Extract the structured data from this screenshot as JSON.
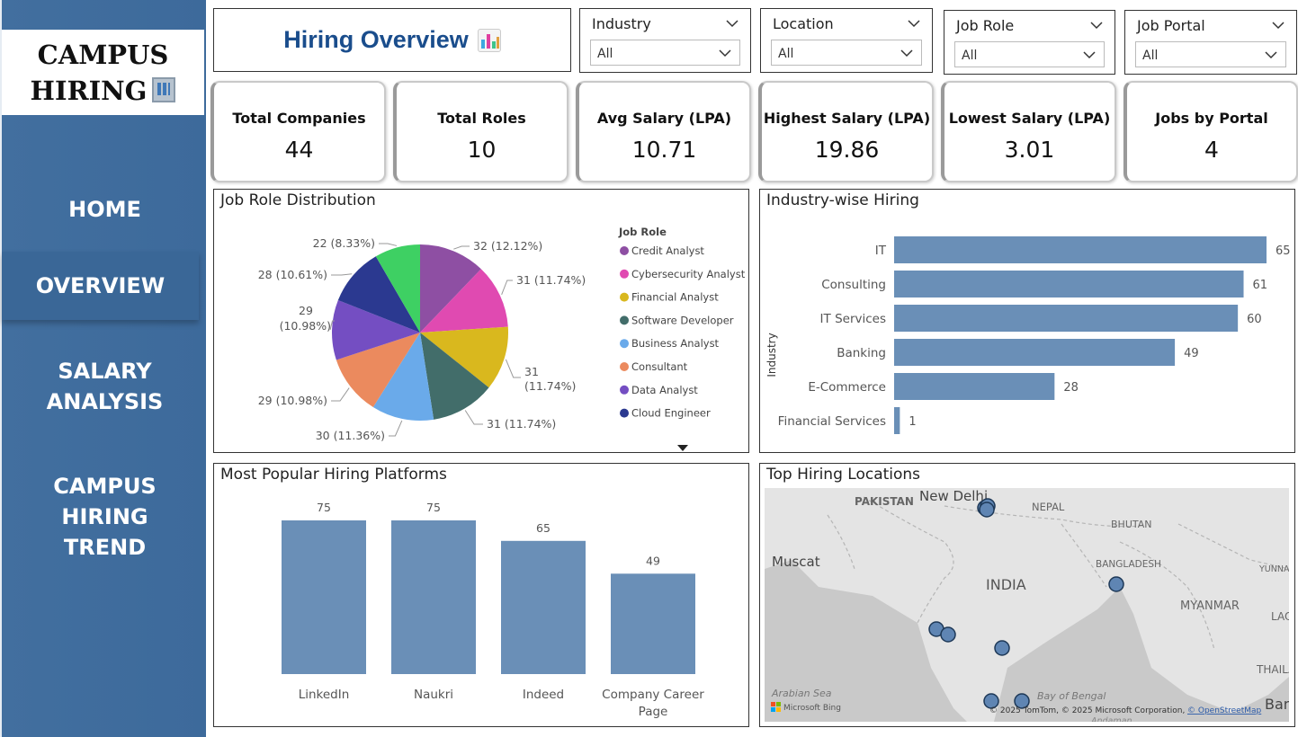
{
  "sidebar": {
    "logo_line1": "CAMPUS",
    "logo_line2": "HIRING",
    "logo_icon": "office-building-icon",
    "nav": [
      {
        "label": "HOME"
      },
      {
        "label": "OVERVIEW"
      },
      {
        "label": "SALARY ANALYSIS"
      },
      {
        "label": "CAMPUS HIRING TREND"
      }
    ],
    "active_nav": "OVERVIEW"
  },
  "header": {
    "title": "Hiring Overview",
    "title_icon": "bar-chart-icon",
    "title_color": "#1a4d8c"
  },
  "slicers": [
    {
      "label": "Industry",
      "value": "All"
    },
    {
      "label": "Location",
      "value": "All"
    },
    {
      "label": "Job Role",
      "value": "All"
    },
    {
      "label": "Job Portal",
      "value": "All"
    }
  ],
  "kpis": [
    {
      "title": "Total Companies",
      "value": "44"
    },
    {
      "title": "Total Roles",
      "value": "10"
    },
    {
      "title": "Avg Salary (LPA)",
      "value": "10.71"
    },
    {
      "title": "Highest Salary (LPA)",
      "value": "19.86"
    },
    {
      "title": "Lowest Salary (LPA)",
      "value": "3.01"
    },
    {
      "title": "Jobs by Portal",
      "value": "4"
    }
  ],
  "panels": {
    "pie_title": "Job Role Distribution",
    "industry_title": "Industry-wise Hiring",
    "platforms_title": "Most Popular Hiring Platforms",
    "map_title": "Top Hiring Locations"
  },
  "chart_data": [
    {
      "type": "pie",
      "title": "Job Role Distribution",
      "legend_title": "Job Role",
      "legend_position": "right",
      "slices": [
        {
          "name": "Credit Analyst",
          "value": 32,
          "label": "32 (12.12%)",
          "color": "#8e4fa3"
        },
        {
          "name": "Cybersecurity Analyst",
          "value": 31,
          "label": "31 (11.74%)",
          "color": "#e04ab1"
        },
        {
          "name": "Financial Analyst",
          "value": 31,
          "label": "31 (11.74%)",
          "color": "#d9b81e"
        },
        {
          "name": "Software Developer",
          "value": 31,
          "label": "31 (11.74%)",
          "color": "#426d6a"
        },
        {
          "name": "Business Analyst",
          "value": 30,
          "label": "30 (11.36%)",
          "color": "#6aaaea"
        },
        {
          "name": "Consultant",
          "value": 29,
          "label": "29 (10.98%)",
          "color": "#eb8a5e"
        },
        {
          "name": "Data Analyst",
          "value": 29,
          "label": "29 (10.98%)",
          "color": "#744ec2"
        },
        {
          "name": "Cloud Engineer",
          "value": 28,
          "label": "28 (10.61%)",
          "color": "#2b3990"
        },
        {
          "name": "",
          "value": 22,
          "label": "22 (8.33%)",
          "color": "#3ed063"
        }
      ]
    },
    {
      "type": "bar",
      "orientation": "horizontal",
      "title": "Industry-wise Hiring",
      "ylabel": "Industry",
      "categories": [
        "IT",
        "Consulting",
        "IT Services",
        "Banking",
        "E-Commerce",
        "Financial Services"
      ],
      "values": [
        65,
        61,
        60,
        49,
        28,
        1
      ],
      "xlim": [
        0,
        65
      ],
      "color": "#6a8fb7",
      "grid": false
    },
    {
      "type": "bar",
      "orientation": "vertical",
      "title": "Most Popular Hiring Platforms",
      "categories": [
        "LinkedIn",
        "Naukri",
        "Indeed",
        "Company Career Page"
      ],
      "values": [
        75,
        75,
        65,
        49
      ],
      "ylim": [
        0,
        75
      ],
      "color": "#6a8fb7",
      "grid": false
    }
  ],
  "map": {
    "labels": [
      "PAKISTAN",
      "New Delhi",
      "NEPAL",
      "BHUTAN",
      "Muscat",
      "BANGLADESH",
      "YUNNAN",
      "INDIA",
      "MYANMAR",
      "LAO",
      "THAILA",
      "Arabian Sea",
      "Bay of Bengal",
      "Ban",
      "Andaman"
    ],
    "attribution": "© 2025 TomTom, © 2025 Microsoft Corporation,",
    "attribution_link": "© OpenStreetMap",
    "provider": "Microsoft Bing",
    "marker_count": 9
  }
}
